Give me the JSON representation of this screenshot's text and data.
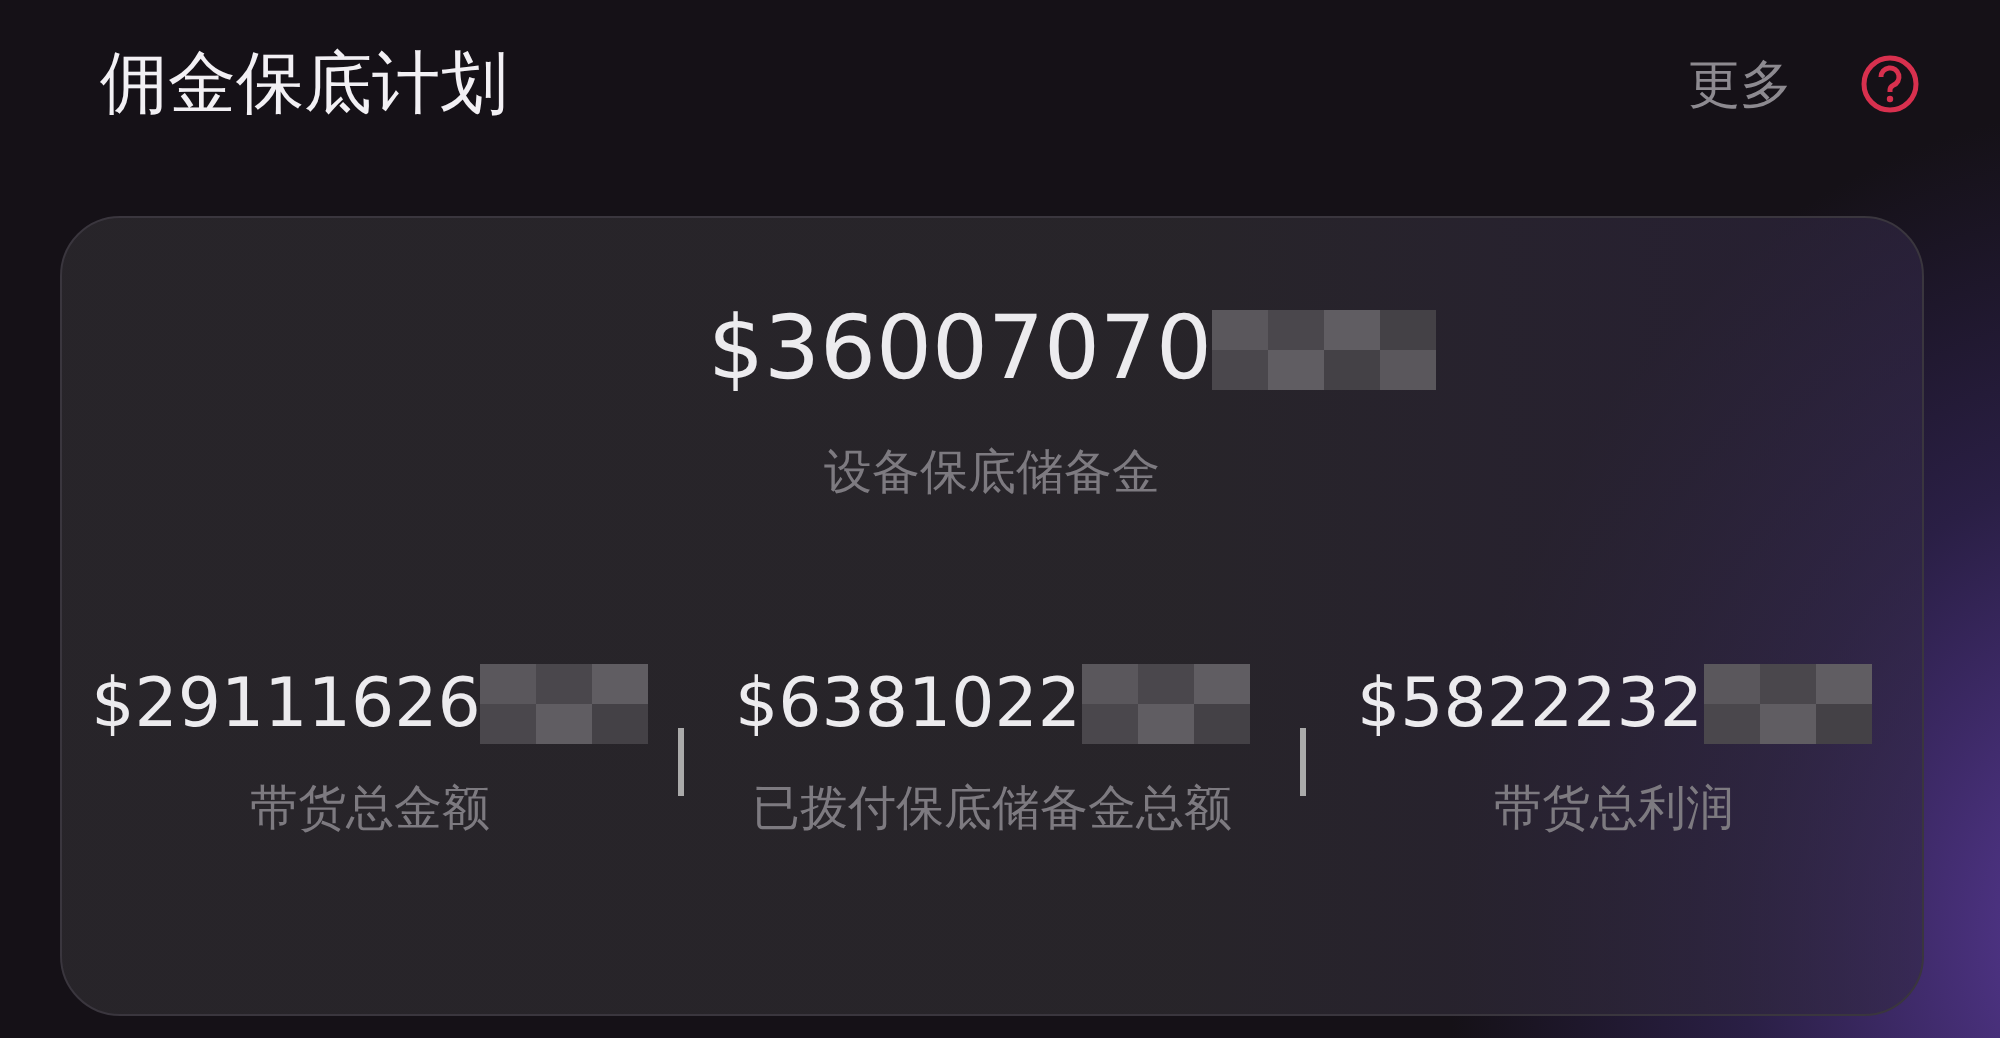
{
  "header": {
    "title": "佣金保底计划",
    "more_link": "更多"
  },
  "summary": {
    "amount": "$36007070",
    "label": "设备保底储备金"
  },
  "stats": [
    {
      "amount": "$29111626",
      "label": "带货总金额"
    },
    {
      "amount": "$6381022",
      "label": "已拨付保底储备金总额"
    },
    {
      "amount": "$5822232",
      "label": "带货总利润"
    }
  ]
}
